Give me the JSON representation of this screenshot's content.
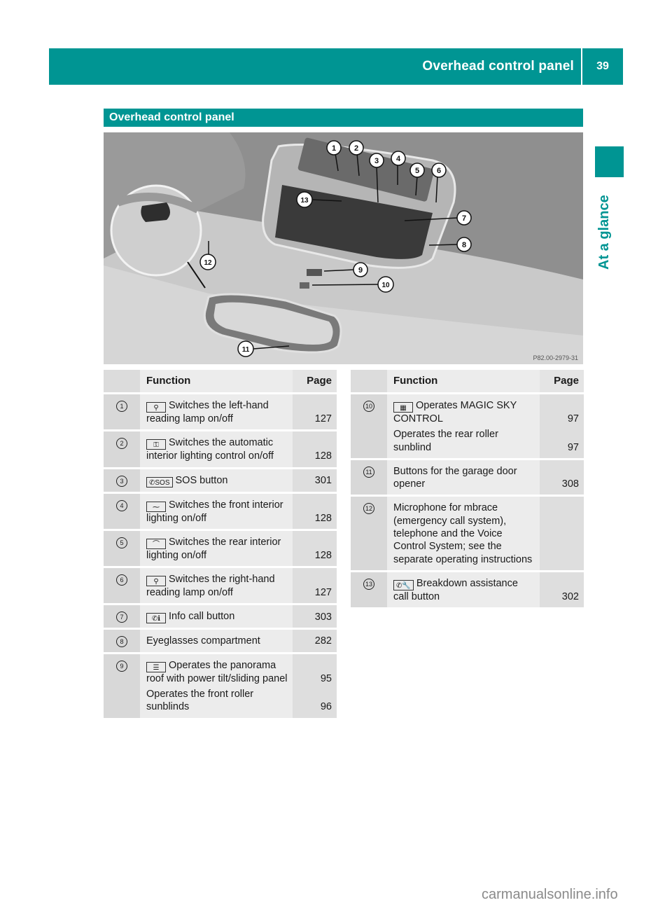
{
  "page_header": {
    "title": "Overhead control panel",
    "page_number": "39"
  },
  "side_tab": {
    "label": "At a glance"
  },
  "section": {
    "title": "Overhead control panel"
  },
  "illustration": {
    "caption_code": "P82.00-2979-31",
    "callouts": [
      "1",
      "2",
      "3",
      "4",
      "5",
      "6",
      "7",
      "8",
      "9",
      "10",
      "11",
      "12",
      "13"
    ]
  },
  "tables": [
    {
      "headers": {
        "function": "Function",
        "page": "Page"
      },
      "rows": [
        {
          "num": "1",
          "icon": "reading-lamp-icon",
          "icon_glyph": "⚲",
          "lines": [
            {
              "text": "Switches the left-hand reading lamp on/off",
              "page": "127"
            }
          ]
        },
        {
          "num": "2",
          "icon": "auto-interior-lighting-off-icon",
          "icon_glyph": "⚿",
          "lines": [
            {
              "text": "Switches the automatic interior lighting control on/off",
              "page": "128"
            }
          ]
        },
        {
          "num": "3",
          "icon": "sos-phone-icon",
          "icon_glyph": "✆SOS",
          "lines": [
            {
              "text": "SOS button",
              "page": "301"
            }
          ]
        },
        {
          "num": "4",
          "icon": "front-interior-light-icon",
          "icon_glyph": "⁓",
          "lines": [
            {
              "text": "Switches the front interior lighting on/off",
              "page": "128"
            }
          ]
        },
        {
          "num": "5",
          "icon": "rear-interior-light-icon",
          "icon_glyph": "⌒",
          "lines": [
            {
              "text": "Switches the rear interior lighting on/off",
              "page": "128"
            }
          ]
        },
        {
          "num": "6",
          "icon": "reading-lamp-icon",
          "icon_glyph": "⚲",
          "lines": [
            {
              "text": "Switches the right-hand reading lamp on/off",
              "page": "127"
            }
          ]
        },
        {
          "num": "7",
          "icon": "info-call-icon",
          "icon_glyph": "✆ℹ",
          "lines": [
            {
              "text": "Info call button",
              "page": "303"
            }
          ]
        },
        {
          "num": "8",
          "icon": "",
          "icon_glyph": "",
          "lines": [
            {
              "text": "Eyeglasses compartment",
              "page": "282"
            }
          ]
        },
        {
          "num": "9",
          "icon": "panorama-roof-icon",
          "icon_glyph": "☰",
          "lines": [
            {
              "text": "Operates the panorama roof with power tilt/sliding panel",
              "page": "95"
            },
            {
              "text": "Operates the front roller sunblinds",
              "page": "96"
            }
          ]
        }
      ]
    },
    {
      "headers": {
        "function": "Function",
        "page": "Page"
      },
      "rows": [
        {
          "num": "10",
          "icon": "magic-sky-control-icon",
          "icon_glyph": "▦",
          "lines": [
            {
              "text": "Operates MAGIC SKY CONTROL",
              "page": "97"
            },
            {
              "text": "Operates the rear roller sunblind",
              "page": "97"
            }
          ]
        },
        {
          "num": "11",
          "icon": "",
          "icon_glyph": "",
          "lines": [
            {
              "text": "Buttons for the garage door opener",
              "page": "308"
            }
          ]
        },
        {
          "num": "12",
          "icon": "",
          "icon_glyph": "",
          "lines": [
            {
              "text": "Microphone for mbrace (emergency call system), telephone and the Voice Control System; see the separate operating instructions",
              "page": ""
            }
          ]
        },
        {
          "num": "13",
          "icon": "breakdown-call-icon",
          "icon_glyph": "✆🔧",
          "lines": [
            {
              "text": "Breakdown assistance call button",
              "page": "302"
            }
          ]
        }
      ]
    }
  ],
  "footer": {
    "watermark": "carmanualsonline.info"
  },
  "colors": {
    "brand_teal": "#009593"
  }
}
